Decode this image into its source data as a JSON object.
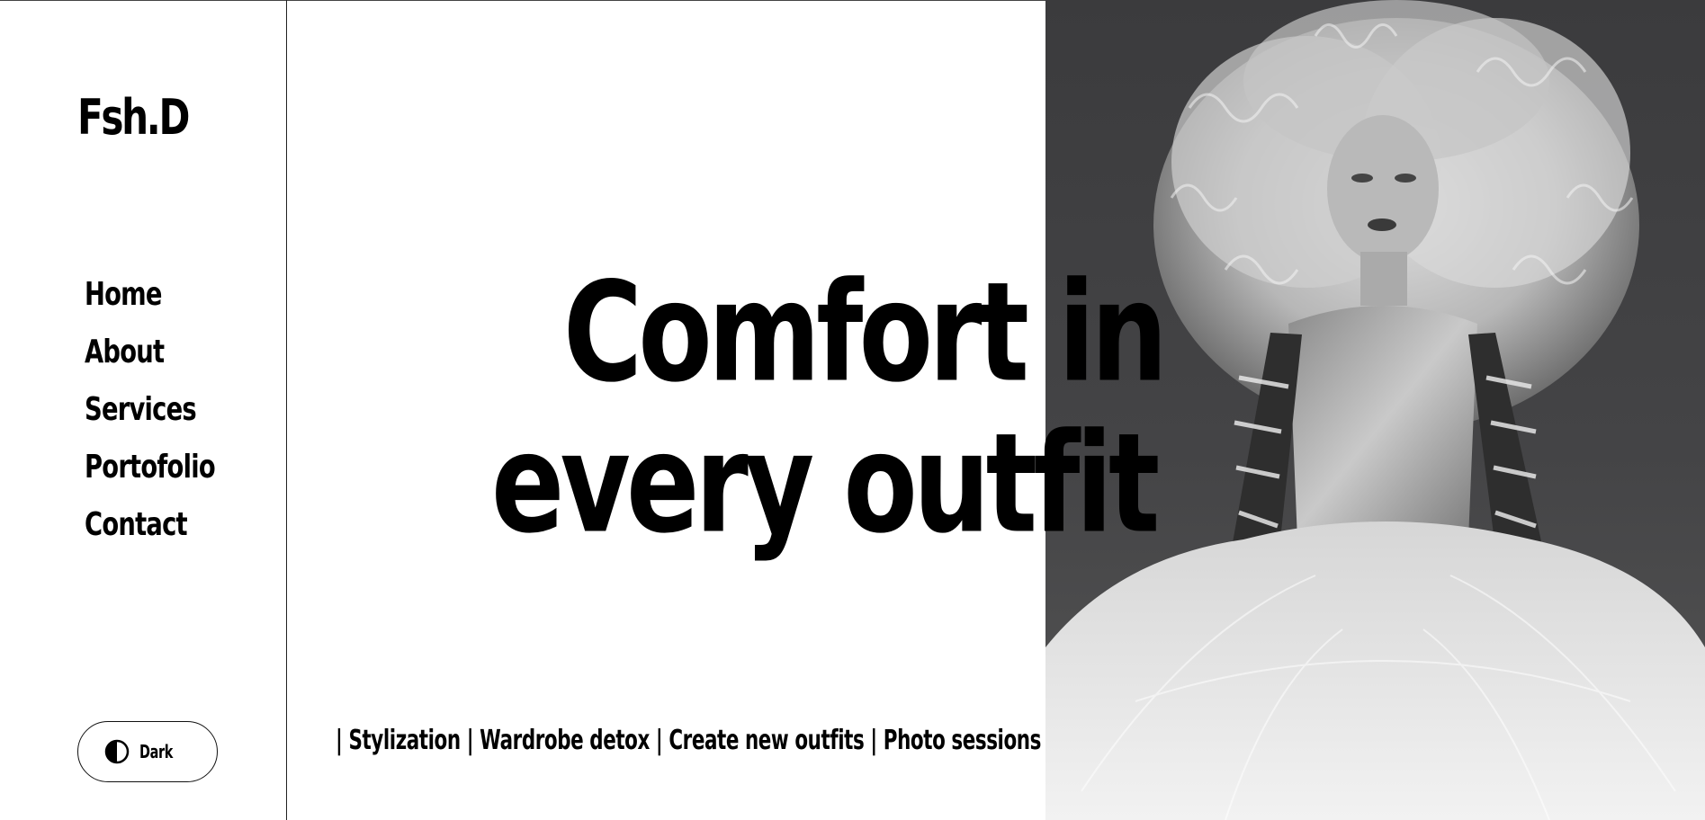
{
  "brand": {
    "logo": "Fsh.D"
  },
  "nav": {
    "items": [
      {
        "label": "Home"
      },
      {
        "label": "About"
      },
      {
        "label": "Services"
      },
      {
        "label": "Portofolio"
      },
      {
        "label": "Contact"
      }
    ]
  },
  "theme_toggle": {
    "label": "Dark",
    "icon": "half-moon-contrast-icon"
  },
  "hero": {
    "headline_line1": "Comfort in",
    "headline_line2": "every outfit",
    "services_line": "| Stylization | Wardrobe detox | Create new outfits | Photo sessions",
    "image_alt": "model-photo"
  },
  "colors": {
    "background": "#ffffff",
    "text": "#000000",
    "photo_bg": "#404042"
  }
}
